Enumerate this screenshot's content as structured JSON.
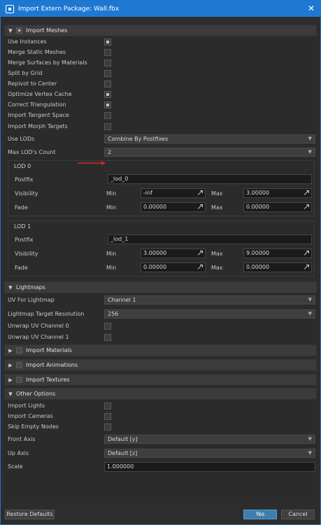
{
  "window": {
    "title": "Import Extern Package: Wall.fbx",
    "close_icon": "close-icon"
  },
  "sections": {
    "meshes": {
      "label": "Import Meshes"
    },
    "lightmaps": {
      "label": "Lightmaps"
    },
    "materials": {
      "label": "Import Materials"
    },
    "animations": {
      "label": "Import Animations"
    },
    "textures": {
      "label": "Import Textures"
    },
    "other": {
      "label": "Other Options"
    }
  },
  "meshes": {
    "rows": [
      {
        "label": "Use Instances",
        "checked": true
      },
      {
        "label": "Merge Static Meshes",
        "checked": false
      },
      {
        "label": "Merge Surfaces by Materials",
        "checked": false
      },
      {
        "label": "Split by Grid",
        "checked": false
      },
      {
        "label": "Repivot to Center",
        "checked": false
      },
      {
        "label": "Optimize Vertex Cache",
        "checked": true
      },
      {
        "label": "Correct Triangulation",
        "checked": true
      },
      {
        "label": "Import Tangent Space",
        "checked": false
      },
      {
        "label": "Import Morph Targets",
        "checked": false
      }
    ],
    "use_lods": {
      "label": "Use LODs",
      "value": "Combine By Postfixes"
    },
    "max_lods": {
      "label": "Max LOD's Count",
      "value": "2"
    }
  },
  "lod0": {
    "title": "LOD 0",
    "postfix_label": "Postfix",
    "postfix": "_lod_0",
    "visibility_label": "Visibility",
    "fade_label": "Fade",
    "min_label": "Min",
    "max_label": "Max",
    "vis_min": "-inf",
    "vis_max": "3.00000",
    "fade_min": "0.00000",
    "fade_max": "0.00000"
  },
  "lod1": {
    "title": "LOD 1",
    "postfix_label": "Postfix",
    "postfix": "_lod_1",
    "visibility_label": "Visibility",
    "fade_label": "Fade",
    "min_label": "Min",
    "max_label": "Max",
    "vis_min": "3.00000",
    "vis_max": "9.00000",
    "fade_min": "0.00000",
    "fade_max": "0.00000"
  },
  "lightmaps": {
    "uv_label": "UV For Lightmap",
    "uv_value": "Channel 1",
    "res_label": "Lightmap Target Resolution",
    "res_value": "256",
    "unwrap0_label": "Unwrap UV Channel 0",
    "unwrap1_label": "Unwrap UV Channel 1"
  },
  "other": {
    "rows": [
      {
        "label": "Import Lights",
        "checked": false
      },
      {
        "label": "Import Cameras",
        "checked": false
      },
      {
        "label": "Skip Empty Nodes",
        "checked": false
      }
    ],
    "front_label": "Front Axis",
    "front_value": "Default [y]",
    "up_label": "Up Axis",
    "up_value": "Default [z]",
    "scale_label": "Scale",
    "scale_value": "1.000000"
  },
  "buttons": {
    "restore": "Restore Defaults",
    "yes": "Yes",
    "cancel": "Cancel"
  },
  "colors": {
    "titlebar": "#1e78d2",
    "primary_button": "#3c7fae",
    "annotation_arrow": "#d62828"
  }
}
